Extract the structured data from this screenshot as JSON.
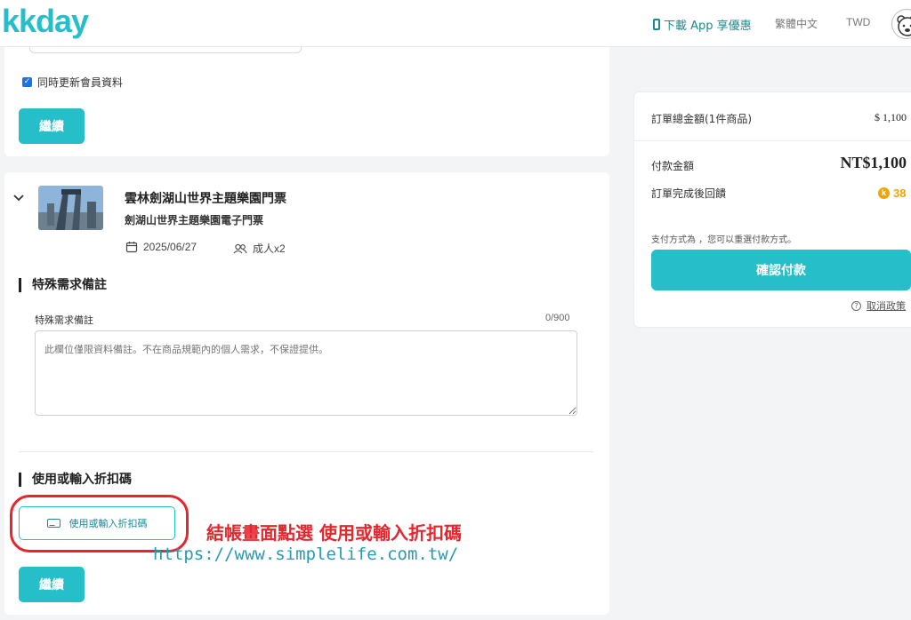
{
  "header": {
    "logo": "kkday",
    "app_download": "下載 App 享優惠",
    "language": "繁體中文",
    "currency": "TWD"
  },
  "contact": {
    "update_member_label": "同時更新會員資料",
    "continue_label": "繼續"
  },
  "product": {
    "title": "雲林劍湖山世界主題樂園門票",
    "subtitle": "劍湖山世界主題樂園電子門票",
    "date": "2025/06/27",
    "pax": "成人x2"
  },
  "special_request": {
    "section_title": "特殊需求備註",
    "field_label": "特殊需求備註",
    "counter": "0/900",
    "placeholder": "此欄位僅限資料備註。不在商品規範內的個人需求，不保證提供。"
  },
  "coupon": {
    "section_title": "使用或輸入折扣碼",
    "button_label": "使用或輸入折扣碼",
    "continue_label": "繼續"
  },
  "annotation": {
    "instruction": "結帳畫面點選 使用或輸入折扣碼",
    "url": "https://www.simplelife.com.tw/"
  },
  "summary": {
    "order_total_label": "訂單總金額(1件商品)",
    "order_total_value": "$ 1,100",
    "pay_amount_label": "付款金額",
    "pay_amount_value": "NT$1,100",
    "reward_label": "訂單完成後回饋",
    "reward_value": "38",
    "payment_note": "支付方式為 ，您可以重選付款方式。",
    "confirm_label": "確認付款",
    "cancel_policy": "取消政策"
  },
  "colors": {
    "brand": "#26bec9",
    "highlight": "#e4262d",
    "reward": "#f0a500"
  }
}
